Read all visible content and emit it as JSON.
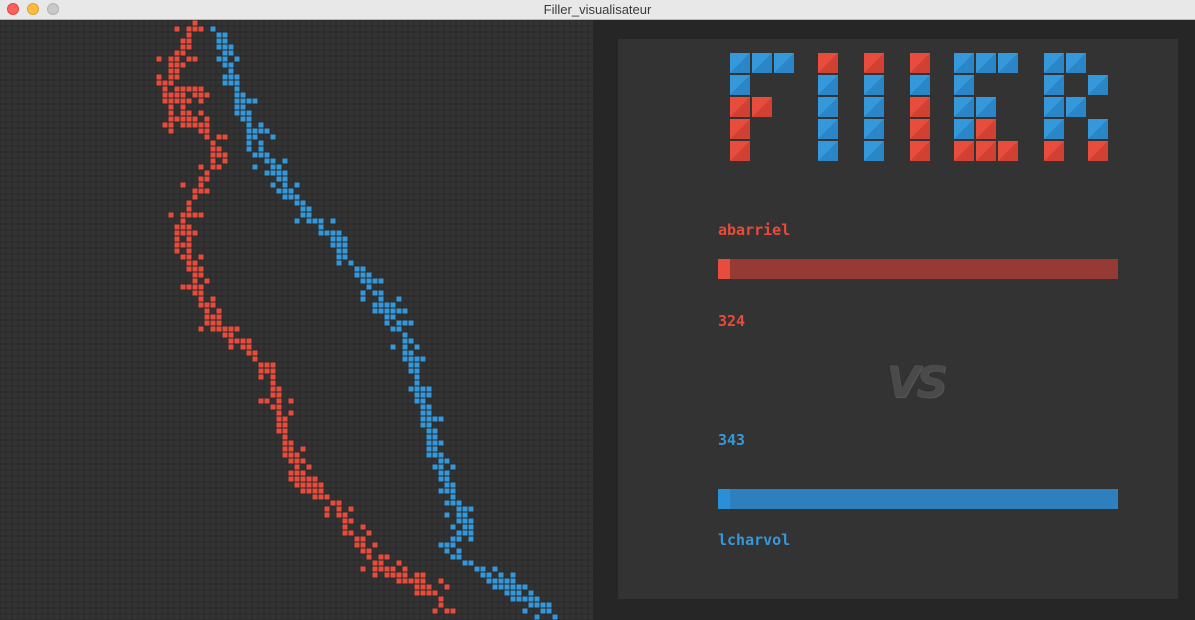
{
  "window": {
    "title": "Filler_visualisateur"
  },
  "logo": {
    "text": "FILLER"
  },
  "players": [
    {
      "name": "abarriel",
      "score": "324",
      "progress": 0.03,
      "color": "#e74c3c"
    },
    {
      "name": "lcharvol",
      "score": "343",
      "progress": 0.03,
      "color": "#3498db"
    }
  ],
  "versus": {
    "label": "VS"
  },
  "colors": {
    "red": "#e74c3c",
    "blue": "#3498db",
    "board_bg": "#2a2a2a",
    "empty_cell": "#333333"
  }
}
